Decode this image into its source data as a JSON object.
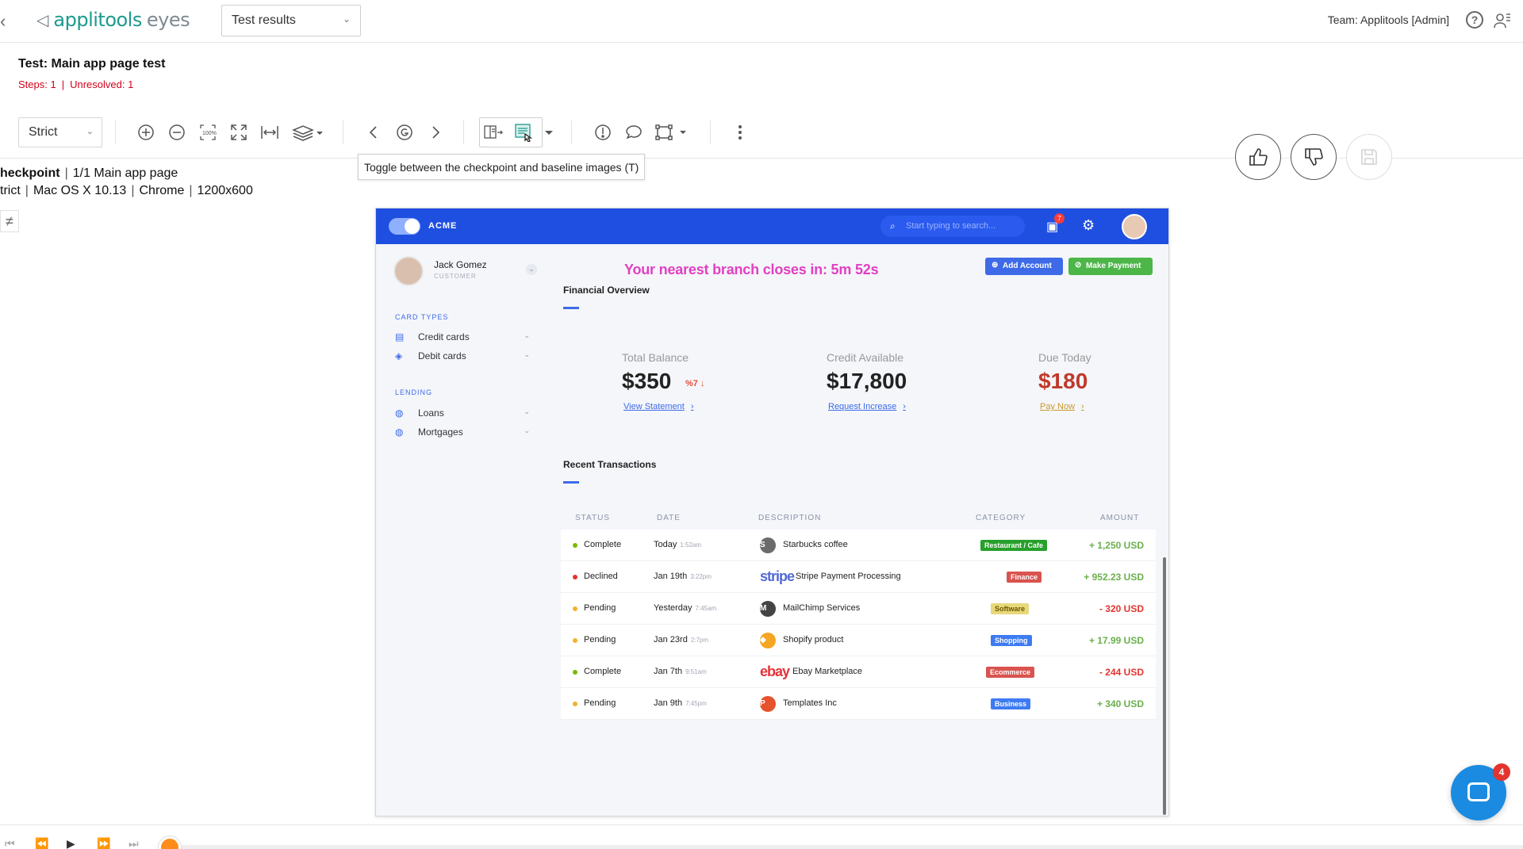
{
  "topbar": {
    "logo_primary": "applitools",
    "logo_secondary": "eyes",
    "results_select": "Test results",
    "team_label": "Team: Applitools [Admin]"
  },
  "test": {
    "title": "Test: Main app page test",
    "steps": "Steps: 1",
    "unresolved": "Unresolved: 1"
  },
  "toolbar": {
    "match_level": "Strict",
    "tooltip": "Toggle between the checkpoint and baseline images (T)"
  },
  "checkpoint": {
    "label": "heckpoint",
    "step": "1/1 Main app page",
    "match": "trict",
    "os": "Mac OS X 10.13",
    "browser": "Chrome",
    "viewport": "1200x600"
  },
  "app": {
    "brand": "ACME",
    "search_placeholder": "Start typing to search...",
    "chat_badge": "7",
    "user_name": "Jack Gomez",
    "user_role": "CUSTOMER",
    "countdown": "Your nearest branch closes in: 5m 52s",
    "add_account": "Add Account",
    "make_payment": "Make Payment",
    "sections": {
      "card_types": "CARD TYPES",
      "lending": "LENDING"
    },
    "nav": [
      "Credit cards",
      "Debit cards",
      "Loans",
      "Mortgages"
    ],
    "financial_overview": "Financial Overview",
    "stats": [
      {
        "label": "Total Balance",
        "value": "$350",
        "delta": "%7 ↓",
        "link": "View Statement"
      },
      {
        "label": "Credit Available",
        "value": "$17,800",
        "link": "Request Increase"
      },
      {
        "label": "Due Today",
        "value": "$180",
        "link": "Pay Now"
      }
    ],
    "recent_transactions": "Recent Transactions",
    "columns": [
      "STATUS",
      "DATE",
      "DESCRIPTION",
      "CATEGORY",
      "AMOUNT"
    ],
    "transactions": [
      {
        "status": "Complete",
        "status_color": "#7ab800",
        "date": "Today",
        "time": "1:52am",
        "logo": "S",
        "logo_bg": "#6b6b6b",
        "description": "Starbucks coffee",
        "category": "Restaurant / Cafe",
        "cat_color": "#27a02b",
        "amount": "+ 1,250 USD",
        "amt_color": "#6ab04c"
      },
      {
        "status": "Declined",
        "status_color": "#e3342f",
        "date": "Jan 19th",
        "time": "3:22pm",
        "logo": "stripe",
        "logo_bg": "#5469d4",
        "description": "Stripe Payment Processing",
        "category": "Finance",
        "cat_color": "#d9534f",
        "amount": "+ 952.23 USD",
        "amt_color": "#6ab04c"
      },
      {
        "status": "Pending",
        "status_color": "#f0b429",
        "date": "Yesterday",
        "time": "7:45am",
        "logo": "M",
        "logo_bg": "#444",
        "description": "MailChimp Services",
        "category": "Software",
        "cat_color": "#e8d87a",
        "amount": "- 320 USD",
        "amt_color": "#e3342f"
      },
      {
        "status": "Pending",
        "status_color": "#f0b429",
        "date": "Jan 23rd",
        "time": "2:7pm",
        "logo": "◆",
        "logo_bg": "#f5a623",
        "description": "Shopify product",
        "category": "Shopping",
        "cat_color": "#3e7bf2",
        "amount": "+ 17.99 USD",
        "amt_color": "#6ab04c"
      },
      {
        "status": "Complete",
        "status_color": "#7ab800",
        "date": "Jan 7th",
        "time": "9:51am",
        "logo": "ebay",
        "logo_bg": "#e53238",
        "description": "Ebay Marketplace",
        "category": "Ecommerce",
        "cat_color": "#d9534f",
        "amount": "- 244 USD",
        "amt_color": "#e3342f"
      },
      {
        "status": "Pending",
        "status_color": "#f0b429",
        "date": "Jan 9th",
        "time": "7:45pm",
        "logo": "P",
        "logo_bg": "#e5532d",
        "description": "Templates Inc",
        "category": "Business",
        "cat_color": "#3e7bf2",
        "amount": "+ 340 USD",
        "amt_color": "#6ab04c"
      }
    ]
  },
  "chat_widget": {
    "badge": "4"
  },
  "colors": {
    "brand": "#1d9a8e",
    "acme_blue": "#1f4fe0",
    "alert": "#d0021b"
  }
}
